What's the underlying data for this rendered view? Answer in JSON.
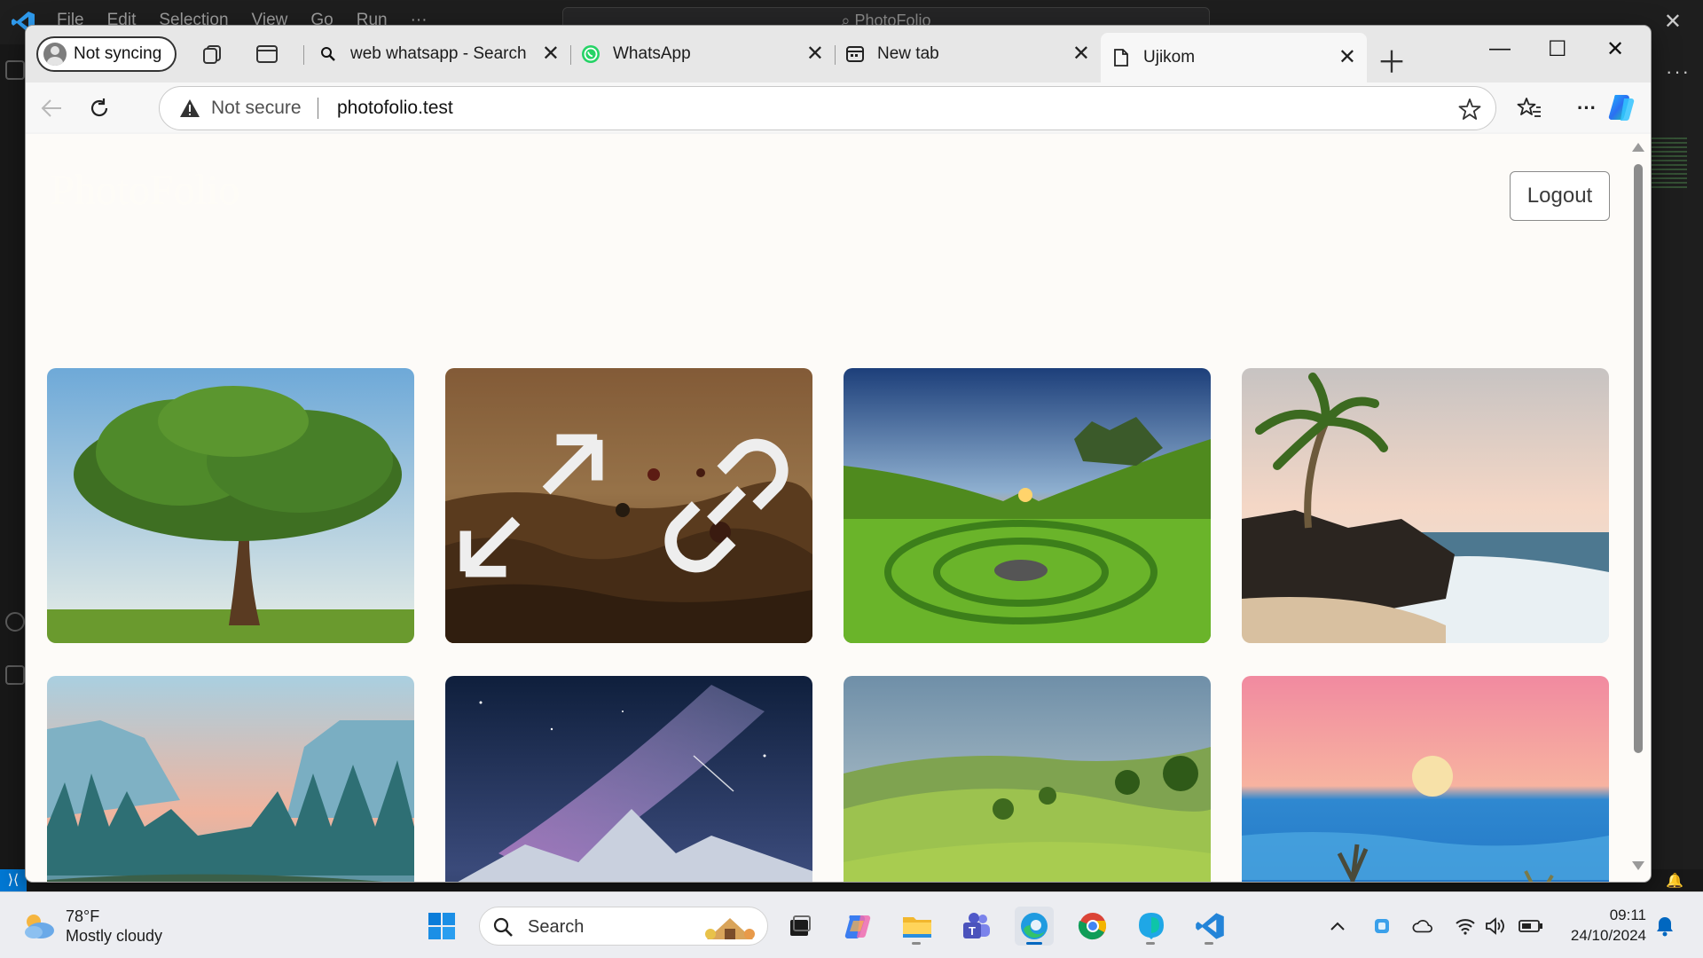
{
  "vscode": {
    "menu": [
      "File",
      "Edit",
      "Selection",
      "View",
      "Go",
      "Run",
      "···"
    ],
    "command_center": "PhotoFolio",
    "more_actions": "···"
  },
  "browser": {
    "profile": {
      "label": "Not syncing"
    },
    "tabs": [
      {
        "title": "web whatsapp - Search",
        "icon": "search-icon",
        "active": false
      },
      {
        "title": "WhatsApp",
        "icon": "whatsapp-icon",
        "active": false
      },
      {
        "title": "New tab",
        "icon": "newtab-icon",
        "active": false
      },
      {
        "title": "Ujikom",
        "icon": "page-icon",
        "active": true
      }
    ],
    "address": {
      "security_label": "Not secure",
      "url": "photofolio.test"
    }
  },
  "page": {
    "brand": "PhotoFolio",
    "logout_label": "Logout",
    "gallery": [
      {
        "name": "tree-photo",
        "hovered": false
      },
      {
        "name": "balloons-photo",
        "hovered": true
      },
      {
        "name": "green-valley-photo",
        "hovered": false
      },
      {
        "name": "palm-beach-photo",
        "hovered": false
      },
      {
        "name": "forest-lake-photo",
        "hovered": false
      },
      {
        "name": "milky-way-photo",
        "hovered": false
      },
      {
        "name": "green-hills-photo",
        "hovered": false
      },
      {
        "name": "moon-sea-photo",
        "hovered": false
      }
    ]
  },
  "taskbar": {
    "weather": {
      "temperature": "78°F",
      "condition": "Mostly cloudy"
    },
    "search_label": "Search",
    "clock": {
      "time": "09:11",
      "date": "24/10/2024"
    }
  },
  "colors": {
    "accent": "#0078d4",
    "page_background": "#fdfbf8",
    "tab_strip": "#e7e7e7"
  }
}
